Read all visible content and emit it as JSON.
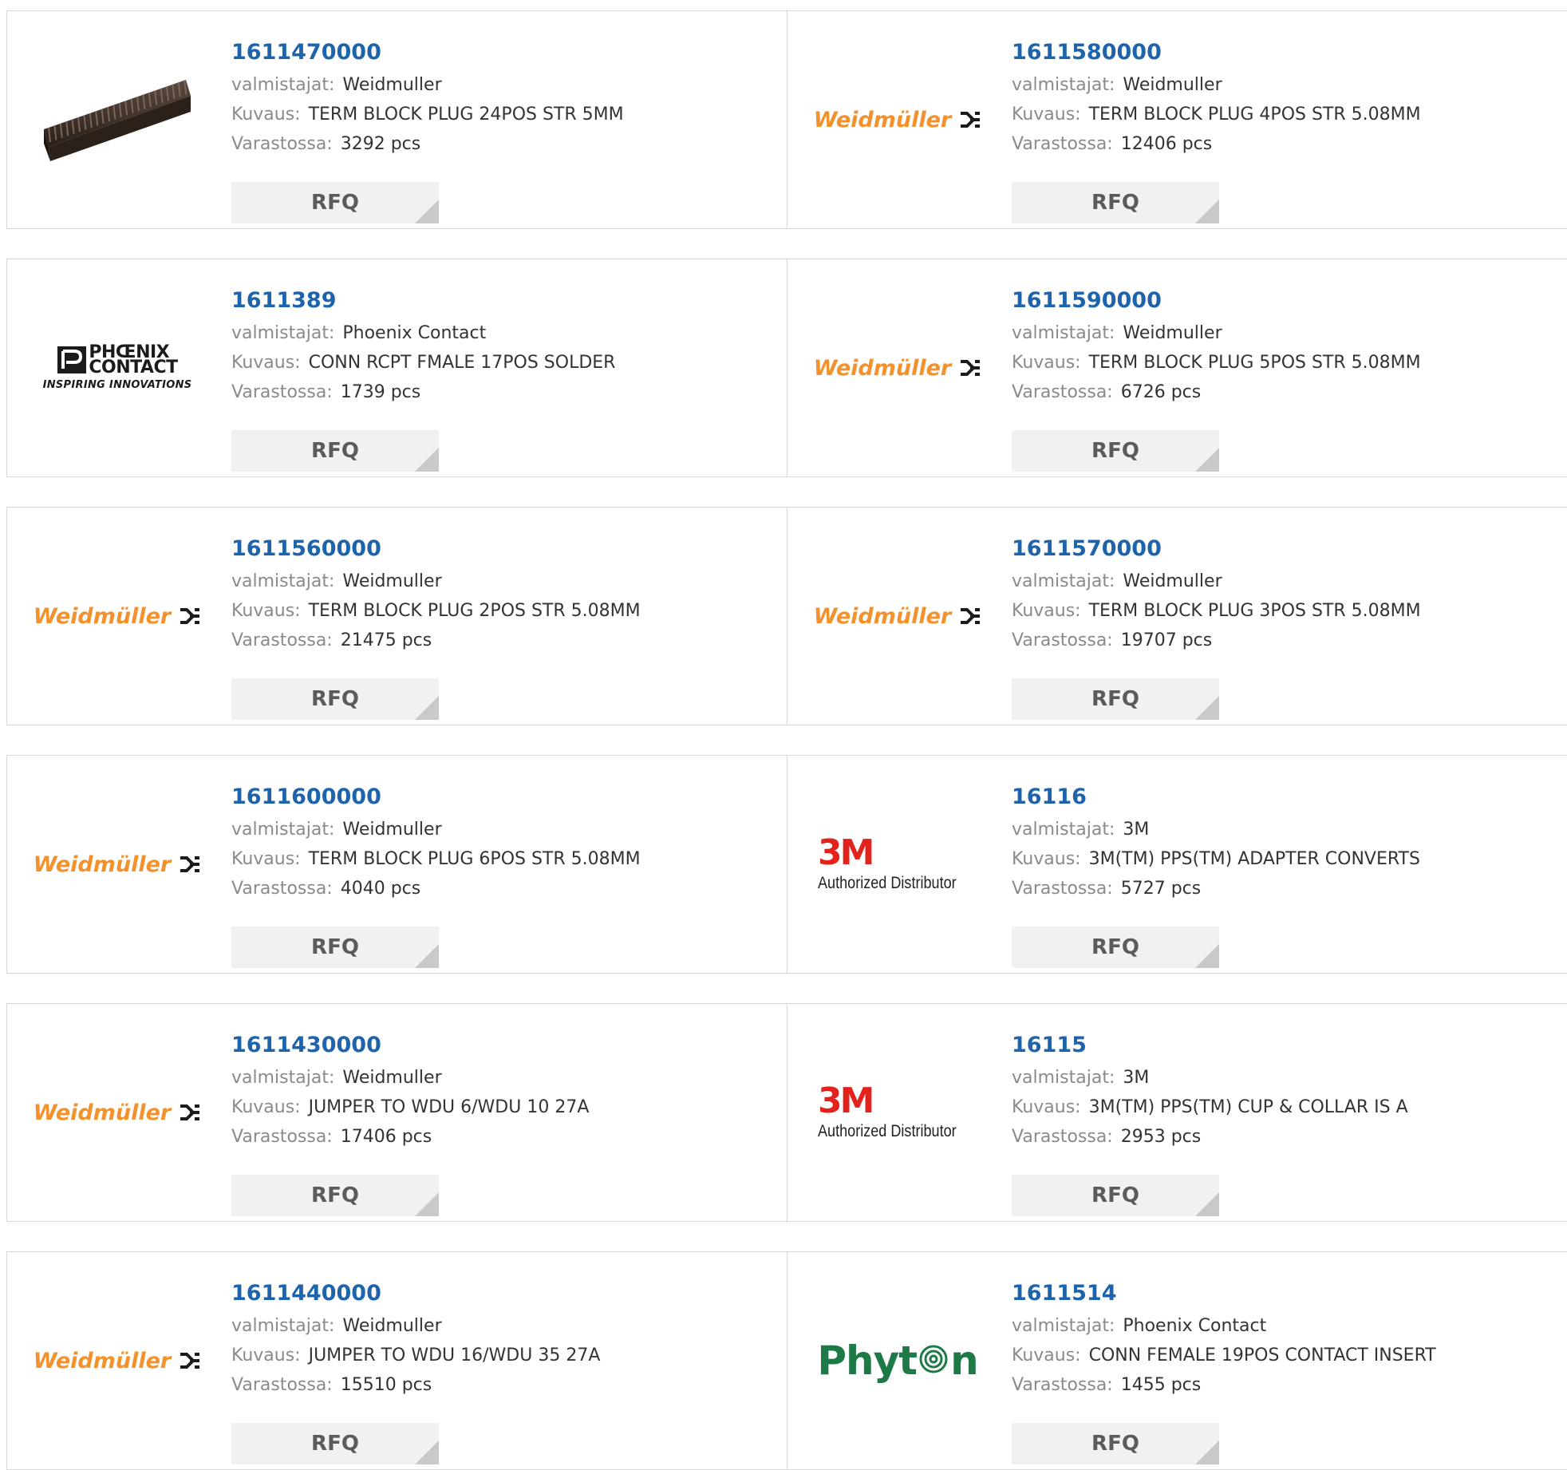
{
  "labels": {
    "manufacturer": "valmistajat:",
    "description": "Kuvaus:",
    "stock": "Varastossa:",
    "rfq": "RFQ"
  },
  "logos": {
    "weidmuller": {
      "text": "Weidmüller",
      "color": "#f3912c"
    },
    "phoenix": {
      "line1": "PHŒNIX",
      "line2": "CONTACT",
      "tagline": "INSPIRING INNOVATIONS"
    },
    "threem": {
      "text": "3M",
      "sub": "Authorized Distributor",
      "color": "#e3231b"
    },
    "phyton": {
      "text_a": "Phyt",
      "text_b": "n",
      "color": "#1d7a46"
    }
  },
  "colors": {
    "part_number": "#1e64ac",
    "label": "#8a8a8a",
    "value": "#333333",
    "rfq_bg": "#f1f1f1"
  },
  "products": [
    {
      "part": "1611470000",
      "logo": "terminal-block-photo",
      "manufacturer": "Weidmuller",
      "description": "TERM BLOCK PLUG 24POS STR 5MM",
      "stock": "3292 pcs"
    },
    {
      "part": "1611580000",
      "logo": "weidmuller",
      "manufacturer": "Weidmuller",
      "description": "TERM BLOCK PLUG 4POS STR 5.08MM",
      "stock": "12406 pcs"
    },
    {
      "part": "1611389",
      "logo": "phoenix",
      "manufacturer": "Phoenix Contact",
      "description": "CONN RCPT FMALE 17POS SOLDER",
      "stock": "1739 pcs"
    },
    {
      "part": "1611590000",
      "logo": "weidmuller",
      "manufacturer": "Weidmuller",
      "description": "TERM BLOCK PLUG 5POS STR 5.08MM",
      "stock": "6726 pcs"
    },
    {
      "part": "1611560000",
      "logo": "weidmuller",
      "manufacturer": "Weidmuller",
      "description": "TERM BLOCK PLUG 2POS STR 5.08MM",
      "stock": "21475 pcs"
    },
    {
      "part": "1611570000",
      "logo": "weidmuller",
      "manufacturer": "Weidmuller",
      "description": "TERM BLOCK PLUG 3POS STR 5.08MM",
      "stock": "19707 pcs"
    },
    {
      "part": "1611600000",
      "logo": "weidmuller",
      "manufacturer": "Weidmuller",
      "description": "TERM BLOCK PLUG 6POS STR 5.08MM",
      "stock": "4040 pcs"
    },
    {
      "part": "16116",
      "logo": "threem",
      "manufacturer": "3M",
      "description": "3M(TM) PPS(TM) ADAPTER CONVERTS",
      "stock": "5727 pcs"
    },
    {
      "part": "1611430000",
      "logo": "weidmuller",
      "manufacturer": "Weidmuller",
      "description": "JUMPER TO WDU 6/WDU 10 27A",
      "stock": "17406 pcs"
    },
    {
      "part": "16115",
      "logo": "threem",
      "manufacturer": "3M",
      "description": "3M(TM) PPS(TM) CUP & COLLAR IS A",
      "stock": "2953 pcs"
    },
    {
      "part": "1611440000",
      "logo": "weidmuller",
      "manufacturer": "Weidmuller",
      "description": "JUMPER TO WDU 16/WDU 35 27A",
      "stock": "15510 pcs"
    },
    {
      "part": "1611514",
      "logo": "phyton",
      "manufacturer": "Phoenix Contact",
      "description": "CONN FEMALE 19POS CONTACT INSERT",
      "stock": "1455 pcs"
    }
  ]
}
